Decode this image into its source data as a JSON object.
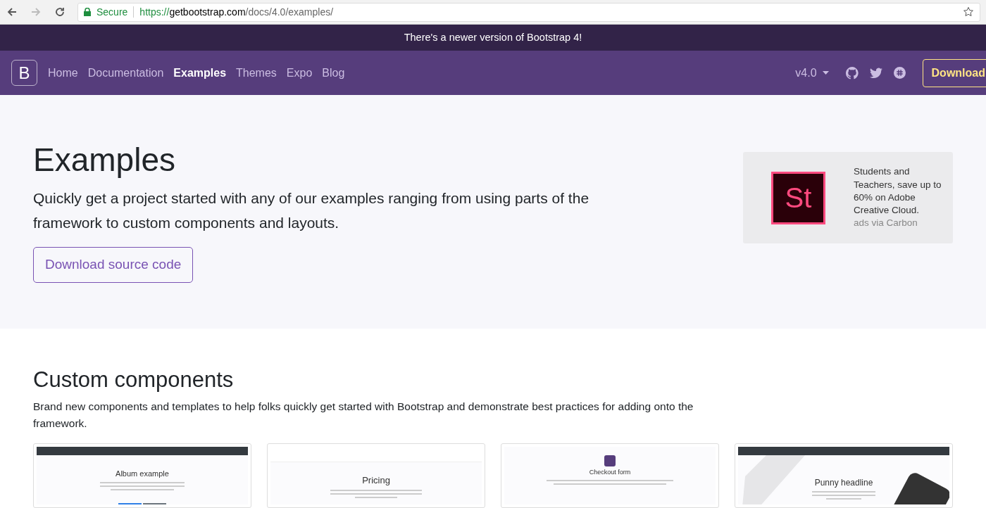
{
  "browser": {
    "secure_label": "Secure",
    "url_scheme": "https://",
    "url_host": "getbootstrap.com",
    "url_path": "/docs/4.0/examples/"
  },
  "banner": {
    "text": "There's a newer version of Bootstrap 4!"
  },
  "navbar": {
    "brand": "B",
    "links": [
      {
        "label": "Home",
        "selected": false
      },
      {
        "label": "Documentation",
        "selected": false
      },
      {
        "label": "Examples",
        "selected": true
      },
      {
        "label": "Themes",
        "selected": false
      },
      {
        "label": "Expo",
        "selected": false
      },
      {
        "label": "Blog",
        "selected": false
      }
    ],
    "version": "v4.0",
    "download": "Download"
  },
  "hero": {
    "title": "Examples",
    "lead": "Quickly get a project started with any of our examples ranging from using parts of the framework to custom components and layouts.",
    "button": "Download source code"
  },
  "ad": {
    "logo": "St",
    "text": "Students and Teachers, save up to 60% on Adobe Creative Cloud.",
    "via": "ads via Carbon"
  },
  "section": {
    "title": "Custom components",
    "description": "Brand new components and templates to help folks quickly get started with Bootstrap and demonstrate best practices for adding onto the framework."
  },
  "thumbnails": [
    {
      "kind": "album",
      "headline": "Album example"
    },
    {
      "kind": "pricing",
      "headline": "Pricing"
    },
    {
      "kind": "checkout",
      "headline": "Checkout form"
    },
    {
      "kind": "product",
      "headline": "Punny headline"
    }
  ]
}
